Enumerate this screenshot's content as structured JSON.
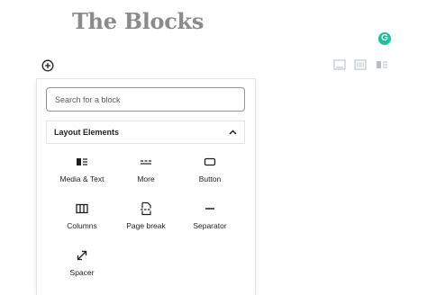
{
  "page": {
    "title": "The Blocks"
  },
  "grammarly": {
    "letter": "G"
  },
  "inserter": {
    "search_placeholder": "Search for a block",
    "panel_title": "Layout Elements",
    "blocks": [
      {
        "label": "Media & Text",
        "icon": "media-text-icon"
      },
      {
        "label": "More",
        "icon": "more-icon"
      },
      {
        "label": "Button",
        "icon": "button-icon"
      },
      {
        "label": "Columns",
        "icon": "columns-icon"
      },
      {
        "label": "Page break",
        "icon": "page-break-icon"
      },
      {
        "label": "Separator",
        "icon": "separator-icon"
      },
      {
        "label": "Spacer",
        "icon": "spacer-icon"
      }
    ]
  }
}
